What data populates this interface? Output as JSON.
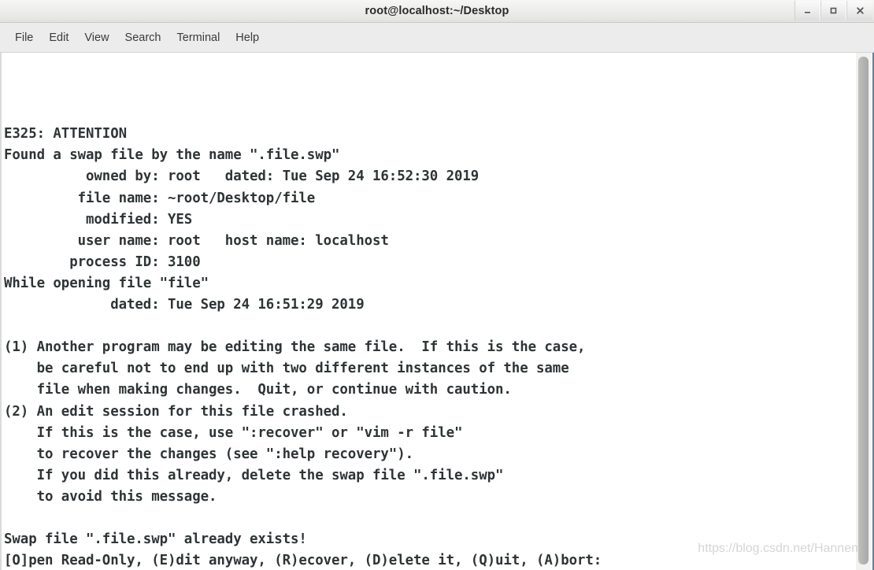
{
  "window": {
    "title": "root@localhost:~/Desktop",
    "controls": [
      {
        "name": "minimize",
        "glyph": "_"
      },
      {
        "name": "maximize",
        "glyph": "□"
      },
      {
        "name": "close",
        "glyph": "×"
      }
    ]
  },
  "menubar": {
    "items": [
      {
        "label": "File"
      },
      {
        "label": "Edit"
      },
      {
        "label": "View"
      },
      {
        "label": "Search"
      },
      {
        "label": "Terminal"
      },
      {
        "label": "Help"
      }
    ]
  },
  "terminal": {
    "lines": [
      "",
      "",
      "",
      "E325: ATTENTION",
      "Found a swap file by the name \".file.swp\"",
      "          owned by: root   dated: Tue Sep 24 16:52:30 2019",
      "         file name: ~root/Desktop/file",
      "          modified: YES",
      "         user name: root   host name: localhost",
      "        process ID: 3100",
      "While opening file \"file\"",
      "             dated: Tue Sep 24 16:51:29 2019",
      "",
      "(1) Another program may be editing the same file.  If this is the case,",
      "    be careful not to end up with two different instances of the same",
      "    file when making changes.  Quit, or continue with caution.",
      "(2) An edit session for this file crashed.",
      "    If this is the case, use \":recover\" or \"vim -r file\"",
      "    to recover the changes (see \":help recovery\").",
      "    If you did this already, delete the swap file \".file.swp\"",
      "    to avoid this message.",
      "",
      "Swap file \".file.swp\" already exists!",
      "[O]pen Read-Only, (E)dit anyway, (R)ecover, (D)elete it, (Q)uit, (A)bort:"
    ],
    "error_code": "E325: ATTENTION",
    "swap_file_name": ".file.swp",
    "owned_by": "root",
    "swap_dated": "Tue Sep 24 16:52:30 2019",
    "file_name": "~root/Desktop/file",
    "modified": "YES",
    "user_name": "root",
    "host_name": "localhost",
    "process_id": "3100",
    "opening_file": "file",
    "file_dated": "Tue Sep 24 16:51:29 2019",
    "prompt_options": [
      "[O]pen Read-Only",
      "(E)dit anyway",
      "(R)ecover",
      "(D)elete it",
      "(Q)uit",
      "(A)bort"
    ],
    "text_color": "#2e3436",
    "background_color": "#ffffff"
  },
  "watermark": {
    "text": "https://blog.csdn.net/Hannen"
  }
}
